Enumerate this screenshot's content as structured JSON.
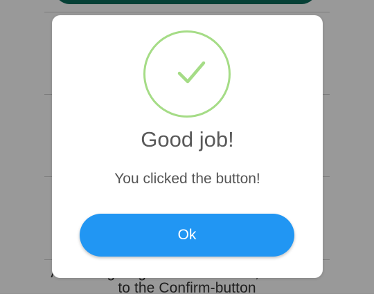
{
  "background": {
    "caption_line1": "A message signals the success, bound",
    "caption_line2": "to the Confirm-button"
  },
  "modal": {
    "icon": "checkmark-icon",
    "title": "Good job!",
    "text": "You clicked the button!",
    "confirm_label": "Ok",
    "colors": {
      "confirm": "#2196f3",
      "success_ring": "#a5dc86",
      "top_button": "#0b6b5b"
    }
  }
}
